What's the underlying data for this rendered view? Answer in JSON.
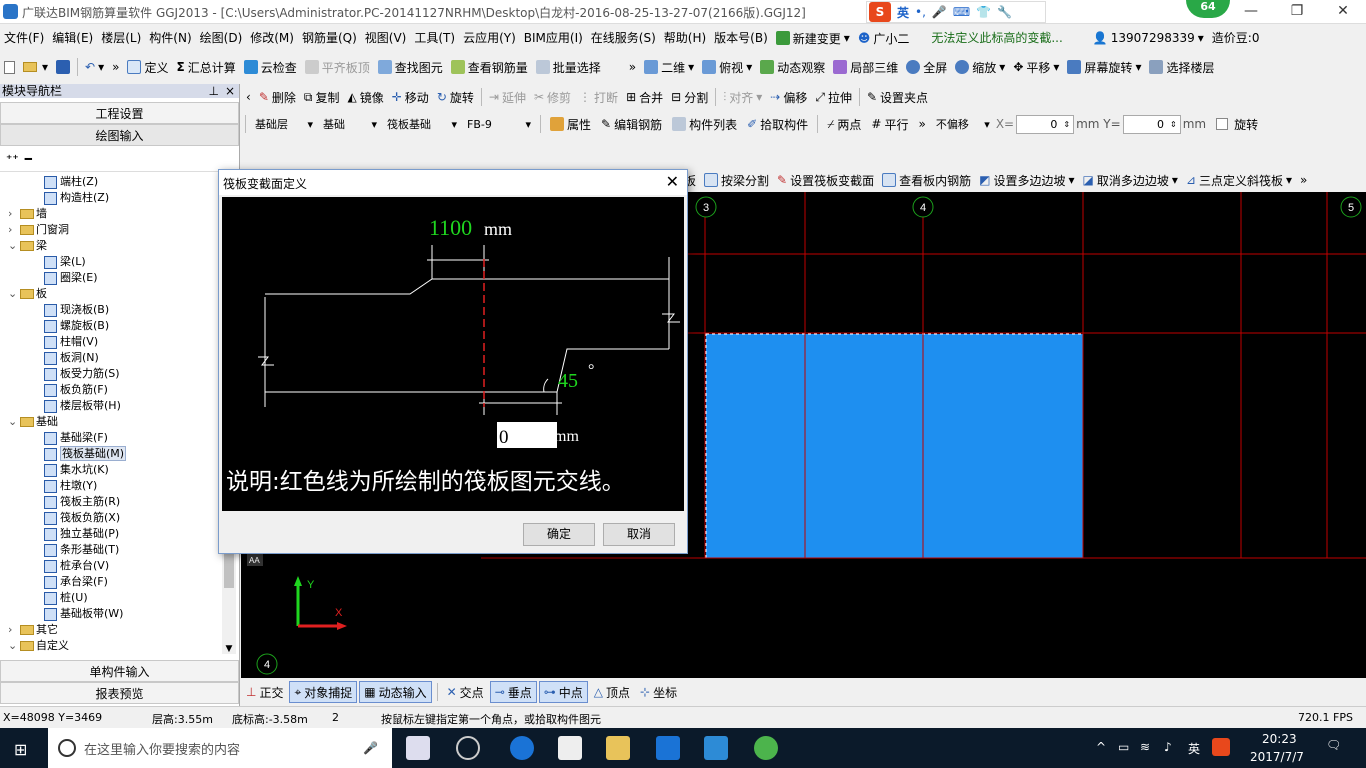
{
  "window": {
    "title": "广联达BIM钢筋算量软件 GGJ2013 - [C:\\Users\\Administrator.PC-20141127NRHM\\Desktop\\白龙村-2016-08-25-13-27-07(2166版).GGJ12]",
    "ime_lang": "英",
    "green_badge": "64"
  },
  "menu": [
    "文件(F)",
    "编辑(E)",
    "楼层(L)",
    "构件(N)",
    "绘图(D)",
    "修改(M)",
    "钢筋量(Q)",
    "视图(V)",
    "工具(T)",
    "云应用(Y)",
    "BIM应用(I)",
    "在线服务(S)",
    "帮助(H)",
    "版本号(B)"
  ],
  "menu_right": {
    "new_change": "新建变更",
    "assistant": "广小二",
    "notice": "无法定义此标高的变截...",
    "phone": "13907298339",
    "price_bean": "造价豆:0"
  },
  "toolbar1": {
    "define": "定义",
    "sum_calc": "汇总计算",
    "cloud_check": "云检查",
    "flat_top": "平齐板顶",
    "find_element": "查找图元",
    "view_rebar": "查看钢筋量",
    "batch_select": "批量选择",
    "view2d": "二维",
    "top_view": "俯视",
    "dynamic_view": "动态观察",
    "local3d": "局部三维",
    "fullscreen": "全屏",
    "zoom": "缩放",
    "pan": "平移",
    "screen_rotate": "屏幕旋转",
    "select_floor": "选择楼层"
  },
  "toolbar2": {
    "delete": "删除",
    "copy": "复制",
    "mirror": "镜像",
    "move": "移动",
    "rotate": "旋转",
    "extend": "延伸",
    "trim": "修剪",
    "break": "打断",
    "merge": "合并",
    "split": "分割",
    "align": "对齐",
    "offset": "偏移",
    "stretch": "拉伸",
    "set_grip": "设置夹点"
  },
  "toolbar3": {
    "layer": "基础层",
    "category": "基础",
    "type": "筏板基础",
    "element": "FB-9",
    "properties": "属性",
    "edit_rebar": "编辑钢筋",
    "element_list": "构件列表",
    "pick_element": "拾取构件",
    "two_points": "两点",
    "parallel": "平行",
    "no_offset": "不偏移",
    "x_label": "X=",
    "x_value": "0",
    "y_label": "mm Y=",
    "y_value": "0",
    "unit": "mm",
    "rotate": "旋转"
  },
  "toolbar4": {
    "slab": "板",
    "split_by_beam": "按梁分割",
    "set_section": "设置筏板变截面",
    "view_slab_rebar": "查看板内钢筋",
    "set_polygon_slope": "设置多边边坡",
    "cancel_polygon_slope": "取消多边边坡",
    "three_point_slope": "三点定义斜筏板"
  },
  "left_panel": {
    "title": "模块导航栏",
    "project_settings": "工程设置",
    "draw_input": "绘图输入",
    "single_input": "单构件输入",
    "report_preview": "报表预览",
    "tree": [
      {
        "label": "端柱(Z)",
        "level": 2,
        "kind": "item"
      },
      {
        "label": "构造柱(Z)",
        "level": 2,
        "kind": "item"
      },
      {
        "label": "墙",
        "level": 1,
        "kind": "folder",
        "expand": "›"
      },
      {
        "label": "门窗洞",
        "level": 1,
        "kind": "folder",
        "expand": "›"
      },
      {
        "label": "梁",
        "level": 1,
        "kind": "folder",
        "expand": "⌄"
      },
      {
        "label": "梁(L)",
        "level": 2,
        "kind": "item"
      },
      {
        "label": "圈梁(E)",
        "level": 2,
        "kind": "item"
      },
      {
        "label": "板",
        "level": 1,
        "kind": "folder",
        "expand": "⌄"
      },
      {
        "label": "现浇板(B)",
        "level": 2,
        "kind": "item"
      },
      {
        "label": "螺旋板(B)",
        "level": 2,
        "kind": "item"
      },
      {
        "label": "柱帽(V)",
        "level": 2,
        "kind": "item"
      },
      {
        "label": "板洞(N)",
        "level": 2,
        "kind": "item"
      },
      {
        "label": "板受力筋(S)",
        "level": 2,
        "kind": "item"
      },
      {
        "label": "板负筋(F)",
        "level": 2,
        "kind": "item"
      },
      {
        "label": "楼层板带(H)",
        "level": 2,
        "kind": "item"
      },
      {
        "label": "基础",
        "level": 1,
        "kind": "folder",
        "expand": "⌄"
      },
      {
        "label": "基础梁(F)",
        "level": 2,
        "kind": "item"
      },
      {
        "label": "筏板基础(M)",
        "level": 2,
        "kind": "item",
        "selected": true
      },
      {
        "label": "集水坑(K)",
        "level": 2,
        "kind": "item"
      },
      {
        "label": "柱墩(Y)",
        "level": 2,
        "kind": "item"
      },
      {
        "label": "筏板主筋(R)",
        "level": 2,
        "kind": "item"
      },
      {
        "label": "筏板负筋(X)",
        "level": 2,
        "kind": "item"
      },
      {
        "label": "独立基础(P)",
        "level": 2,
        "kind": "item"
      },
      {
        "label": "条形基础(T)",
        "level": 2,
        "kind": "item"
      },
      {
        "label": "桩承台(V)",
        "level": 2,
        "kind": "item"
      },
      {
        "label": "承台梁(F)",
        "level": 2,
        "kind": "item"
      },
      {
        "label": "桩(U)",
        "level": 2,
        "kind": "item"
      },
      {
        "label": "基础板带(W)",
        "level": 2,
        "kind": "item"
      },
      {
        "label": "其它",
        "level": 1,
        "kind": "folder",
        "expand": "›"
      },
      {
        "label": "自定义",
        "level": 1,
        "kind": "folder",
        "expand": "⌄"
      }
    ]
  },
  "dialog": {
    "title": "筏板变截面定义",
    "width_value": "1100",
    "width_unit": "mm",
    "angle_value": "45",
    "angle_unit": "°",
    "height_input": "0",
    "height_unit": "mm",
    "note": "说明:红色线为所绘制的筏板图元交线。",
    "ok": "确定",
    "cancel": "取消"
  },
  "canvas": {
    "axis_labels": [
      "3",
      "4",
      "5",
      "4"
    ],
    "cross_label": "AA",
    "x_axis": "X",
    "y_axis": "Y"
  },
  "snapbar": {
    "ortho": "正交",
    "object_snap": "对象捕捉",
    "dynamic_input": "动态输入",
    "intersection": "交点",
    "perpendicular": "垂点",
    "midpoint": "中点",
    "vertex": "顶点",
    "coordinate": "坐标"
  },
  "status": {
    "coords": "X=48098 Y=3469",
    "floor_height": "层高:3.55m",
    "base_height": "底标高:-3.58m",
    "num": "2",
    "hint": "按鼠标左键指定第一个角点，或拾取构件图元",
    "fps": "720.1 FPS"
  },
  "taskbar": {
    "search_placeholder": "在这里输入你要搜索的内容",
    "time": "20:23",
    "date": "2017/7/7",
    "ime": "英"
  }
}
